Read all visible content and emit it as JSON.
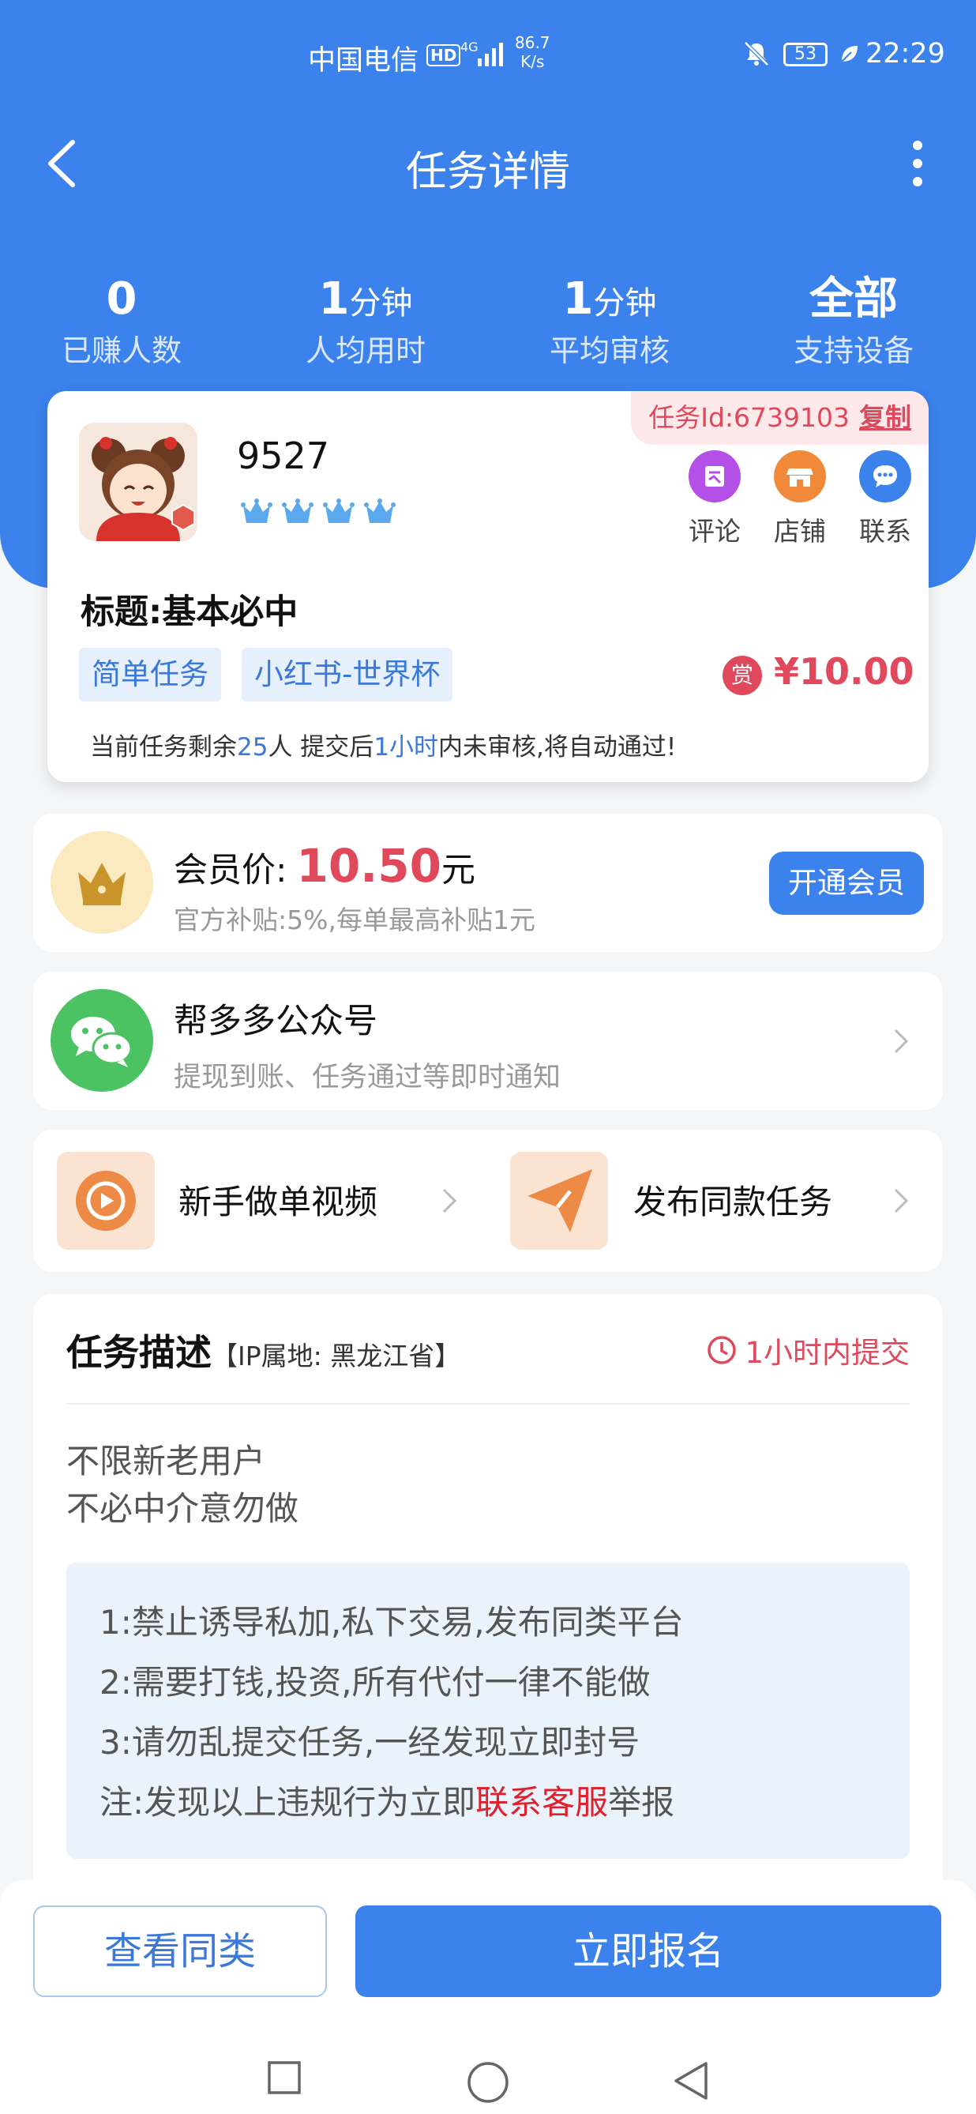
{
  "status_bar": {
    "carrier": "中国电信",
    "hd": "HD",
    "network": "4G",
    "speed_value": "86.7",
    "speed_unit": "K/s",
    "battery": "53",
    "time": "22:29"
  },
  "header": {
    "title": "任务详情"
  },
  "stats": [
    {
      "value": "0",
      "unit": "",
      "label": "已赚人数"
    },
    {
      "value": "1",
      "unit": "分钟",
      "label": "人均用时"
    },
    {
      "value": "1",
      "unit": "分钟",
      "label": "平均审核"
    },
    {
      "value": "全部",
      "unit": "",
      "label": "支持设备"
    }
  ],
  "task": {
    "id_label": "任务Id:6739103",
    "copy_label": "复制",
    "username": "9527",
    "crown_count": 4,
    "actions": [
      {
        "label": "评论",
        "color": "#b44fe8"
      },
      {
        "label": "店铺",
        "color": "#f08a3a"
      },
      {
        "label": "联系",
        "color": "#3b82ec"
      }
    ],
    "title": "标题:基本必中",
    "tags": [
      "简单任务",
      "小红书-世界杯"
    ],
    "reward_icon": "赏",
    "reward": "¥10.00",
    "note_prefix": "当前任务剩余",
    "note_count": "25",
    "note_mid": "人  提交后",
    "note_time": "1小时",
    "note_suffix": "内未审核,将自动通过!"
  },
  "member": {
    "label": "会员价:",
    "price": "10.50",
    "unit": "元",
    "subsidy": "官方补贴:5%,每单最高补贴1元",
    "button": "开通会员"
  },
  "wechat": {
    "title": "帮多多公众号",
    "subtitle": "提现到账、任务通过等即时通知"
  },
  "quick_actions": [
    {
      "label": "新手做单视频",
      "icon": "play-icon"
    },
    {
      "label": "发布同款任务",
      "icon": "send-icon"
    }
  ],
  "description": {
    "title": "任务描述",
    "ip": "【IP属地: 黑龙江省】",
    "deadline": "1小时内提交",
    "lines": [
      "不限新老用户",
      "不必中介意勿做"
    ],
    "rules": [
      "1:禁止诱导私加,私下交易,发布同类平台",
      "2:需要打钱,投资,所有代付一律不能做",
      "3:请勿乱提交任务,一经发现立即封号"
    ],
    "notice_prefix": "注:发现以上违规行为立即",
    "notice_link": "联系客服",
    "notice_suffix": "举报"
  },
  "bottom": {
    "secondary": "查看同类",
    "primary": "立即报名"
  },
  "colors": {
    "primary": "#3b82ec",
    "danger": "#e0485b"
  }
}
